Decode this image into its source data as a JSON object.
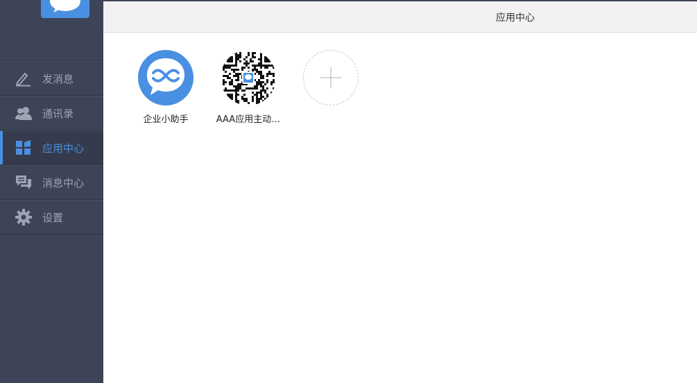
{
  "sidebar": {
    "logo": "chat-bubble-logo",
    "items": [
      {
        "label": "发消息",
        "icon": "pencil-icon",
        "active": false
      },
      {
        "label": "通讯录",
        "icon": "contacts-icon",
        "active": false
      },
      {
        "label": "应用中心",
        "icon": "apps-grid-icon",
        "active": true
      },
      {
        "label": "消息中心",
        "icon": "messages-icon",
        "active": false
      },
      {
        "label": "设置",
        "icon": "gear-icon",
        "active": false
      }
    ]
  },
  "header": {
    "title": "应用中心"
  },
  "apps": [
    {
      "name": "企业小助手",
      "icon": "assistant-icon"
    },
    {
      "name": "AAA应用主动…",
      "icon": "qr-code-icon"
    }
  ],
  "add_app": {
    "icon": "plus-icon"
  },
  "colors": {
    "accent": "#4a90e2",
    "sidebar_bg": "#3d4457",
    "sidebar_text": "#9ea4b4",
    "header_bg": "#f2f2f2"
  }
}
